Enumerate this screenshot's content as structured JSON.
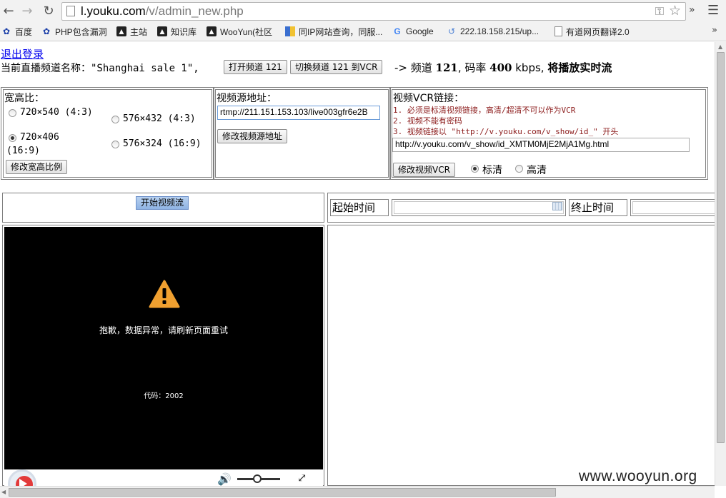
{
  "browser": {
    "url_host": "l.youku.com",
    "url_path": "/v/admin_new.php",
    "ext_more": "»",
    "bookmarks": [
      {
        "label": "百度",
        "icon": "paw-icon"
      },
      {
        "label": "PHP包含漏洞",
        "icon": "paw-icon"
      },
      {
        "label": "主站",
        "icon": "bookmark-page-icon"
      },
      {
        "label": "知识库",
        "icon": "bookmark-page-icon"
      },
      {
        "label": "WooYun(社区",
        "icon": "bookmark-page-icon"
      },
      {
        "label": "同IP网站查询，同服...",
        "icon": "ip-site-icon"
      },
      {
        "label": "Google",
        "icon": "google-icon"
      },
      {
        "label": "222.18.158.215/up...",
        "icon": "loading-icon"
      },
      {
        "label": "有道网页翻译2.0",
        "icon": "document-icon"
      }
    ],
    "bookmarks_more": "»"
  },
  "header": {
    "logout": "退出登录",
    "channel_name_line": "当前直播频道名称：\"Shanghai sale 1\",",
    "open_channel_btn": "打开频道 121",
    "switch_channel_btn": "切换频道 121 到VCR",
    "status_prefix": "-> 频道 ",
    "channel_no": "121",
    "status_mid": ", 码率 ",
    "bitrate": "400",
    "status_unit": " kbps, ",
    "status_action": "将播放实时流"
  },
  "ratio_panel": {
    "title": "宽高比：",
    "options": [
      {
        "label": "720×540 (4:3)",
        "selected": false
      },
      {
        "label": "576×432 (4:3)",
        "selected": false
      },
      {
        "label": "720×406",
        "label2": "(16:9)",
        "selected": true
      },
      {
        "label": "576×324 (16:9)",
        "selected": false
      }
    ],
    "submit": "修改宽高比例"
  },
  "source_panel": {
    "title": "视频源地址：",
    "value": "rtmp://211.151.153.103/live003gfr6e2B",
    "submit": "修改视频源地址"
  },
  "vcr_panel": {
    "title": "视频VCR链接：",
    "notes": [
      "1. 必须是标清视频链接，高清/超清不可以作为VCR",
      "2. 视频不能有密码",
      "3. 视频链接以 \"http://v.youku.com/v_show/id_\" 开头"
    ],
    "value": "http://v.youku.com/v_show/id_XMTM0MjE2MjA1Mg.html",
    "submit": "修改视频VCR",
    "quality_options": [
      {
        "label": "标清",
        "selected": true
      },
      {
        "label": "高清",
        "selected": false
      }
    ]
  },
  "stream": {
    "start_btn": "开始视频流",
    "start_time_label": "起始时间",
    "end_time_label": "终止时间",
    "start_time_value": "",
    "end_time_value": ""
  },
  "player": {
    "error_message": "抱歉，数据异常，请刷新页面重试",
    "error_code": "代码：2002",
    "volume": 0.45
  },
  "watermark": "www.wooyun.org"
}
